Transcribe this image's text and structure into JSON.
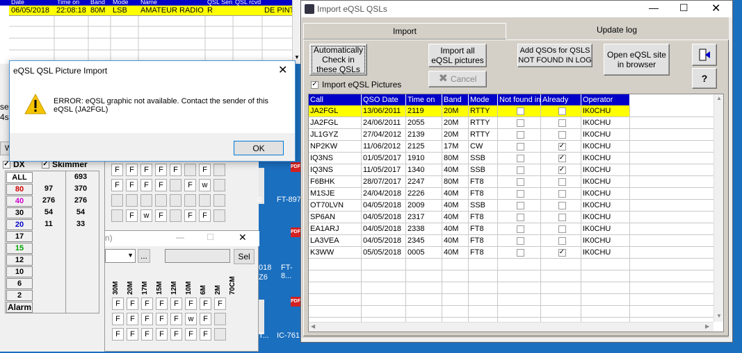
{
  "bg_log": {
    "date": "06/05/2018",
    "time": "22:08:18",
    "band": "80M",
    "mode": "LSB",
    "name": "AMATEUR RADIO C",
    "col6": "R",
    "col8": "DE PINTO",
    "headers": [
      "Date",
      "Time on",
      "Band",
      "Mode",
      "Name",
      "QSL Sen",
      "QSL rcvd"
    ]
  },
  "left_panel": {
    "tabs": [
      "DX",
      "Skimmer"
    ],
    "bands": [
      "ALL",
      "80",
      "40",
      "30",
      "20",
      "17",
      "15",
      "12",
      "10",
      "6",
      "2"
    ],
    "col1": [
      "",
      "97",
      "276",
      "54",
      "11",
      "",
      "",
      "",
      "",
      "",
      ""
    ],
    "col2": [
      "693",
      "370",
      "276",
      "54",
      "33",
      "",
      "",
      "",
      "",
      "",
      ""
    ],
    "alarm": "Alarm",
    "side_labels": [
      "se",
      "4s",
      "W"
    ]
  },
  "mid_panel": {
    "grid_rows": [
      [
        "F",
        "F",
        "F",
        "F",
        "F",
        "",
        "F",
        ""
      ],
      [
        "F",
        "F",
        "F",
        "F",
        "",
        "F",
        "w",
        ""
      ],
      [
        "",
        "",
        "",
        "",
        "",
        "",
        "",
        ""
      ],
      [
        "",
        "F",
        "w",
        "F",
        "",
        "F",
        "F",
        ""
      ]
    ],
    "cols": [
      "30M",
      "20M",
      "17M",
      "15M",
      "12M",
      "10M",
      "6M",
      "2M",
      "70CM"
    ],
    "grid_rows2": [
      [
        "F",
        "F",
        "F",
        "F",
        "F",
        "F",
        "F",
        "F"
      ],
      [
        "F",
        "F",
        "F",
        "F",
        "F",
        "w",
        "F",
        ""
      ],
      [
        "F",
        "F",
        "F",
        "F",
        "F",
        "F",
        "F",
        ""
      ]
    ],
    "sel": "Sel",
    "ellipsis": "...",
    "h_label": "n)"
  },
  "desktop": {
    "icons": [
      {
        "label": "FT-897"
      },
      {
        "label": "FT-8..."
      },
      {
        "label": "IC-761"
      }
    ],
    "pdf": "PDF",
    "d_label": "d",
    "l18": "018",
    "z6": "Z6",
    "t_label": "T..."
  },
  "msgbox": {
    "title": "eQSL QSL Picture Import",
    "message_line1": "ERROR: eQSL graphic not available. Contact the sender of this",
    "message_line2": "eQSL (JA2FGL)",
    "ok": "OK"
  },
  "import_win": {
    "title": "Import eQSL QSLs",
    "tab_import": "Import",
    "tab_update": "Update log",
    "btn_auto": "Automatically Check in these QSLs",
    "btn_import_all": "Import all eQSL pictures",
    "btn_cancel": "Cancel",
    "btn_add": "Add QSOs for QSLS NOT FOUND IN LOG",
    "btn_open": "Open eQSL site in browser",
    "import_pictures_label": "Import eQSL Pictures",
    "columns": [
      "Call",
      "QSO Date",
      "Time on",
      "Band",
      "Mode",
      "Not found in",
      "Already",
      "Operator"
    ],
    "rows": [
      {
        "call": "JA2FGL",
        "date": "13/06/2011",
        "time": "2119",
        "band": "20M",
        "mode": "RTTY",
        "nf": false,
        "al": false,
        "op": "IK0CHU"
      },
      {
        "call": "JA2FGL",
        "date": "24/06/2011",
        "time": "2055",
        "band": "20M",
        "mode": "RTTY",
        "nf": false,
        "al": false,
        "op": "IK0CHU"
      },
      {
        "call": "JL1GYZ",
        "date": "27/04/2012",
        "time": "2139",
        "band": "20M",
        "mode": "RTTY",
        "nf": false,
        "al": false,
        "op": "IK0CHU"
      },
      {
        "call": "NP2KW",
        "date": "11/06/2012",
        "time": "2125",
        "band": "17M",
        "mode": "CW",
        "nf": false,
        "al": true,
        "op": "IK0CHU"
      },
      {
        "call": "IQ3NS",
        "date": "01/05/2017",
        "time": "1910",
        "band": "80M",
        "mode": "SSB",
        "nf": false,
        "al": true,
        "op": "IK0CHU"
      },
      {
        "call": "IQ3NS",
        "date": "11/05/2017",
        "time": "1340",
        "band": "40M",
        "mode": "SSB",
        "nf": false,
        "al": true,
        "op": "IK0CHU"
      },
      {
        "call": "F6BHK",
        "date": "28/07/2017",
        "time": "2247",
        "band": "80M",
        "mode": "FT8",
        "nf": false,
        "al": false,
        "op": "IK0CHU"
      },
      {
        "call": "M1SJE",
        "date": "24/04/2018",
        "time": "2226",
        "band": "40M",
        "mode": "FT8",
        "nf": false,
        "al": false,
        "op": "IK0CHU"
      },
      {
        "call": "OT70LVN",
        "date": "04/05/2018",
        "time": "2009",
        "band": "40M",
        "mode": "SSB",
        "nf": false,
        "al": false,
        "op": "IK0CHU"
      },
      {
        "call": "SP6AN",
        "date": "04/05/2018",
        "time": "2317",
        "band": "40M",
        "mode": "FT8",
        "nf": false,
        "al": false,
        "op": "IK0CHU"
      },
      {
        "call": "EA1ARJ",
        "date": "04/05/2018",
        "time": "2338",
        "band": "40M",
        "mode": "FT8",
        "nf": false,
        "al": false,
        "op": "IK0CHU"
      },
      {
        "call": "LA3VEA",
        "date": "04/05/2018",
        "time": "2345",
        "band": "40M",
        "mode": "FT8",
        "nf": false,
        "al": false,
        "op": "IK0CHU"
      },
      {
        "call": "K3WW",
        "date": "05/05/2018",
        "time": "0005",
        "band": "40M",
        "mode": "FT8",
        "nf": false,
        "al": true,
        "op": "IK0CHU"
      }
    ]
  },
  "colors": {
    "header_blue": "#0000c8",
    "highlight_yellow": "#ffff00",
    "desktop_blue": "#1b6fbf"
  }
}
